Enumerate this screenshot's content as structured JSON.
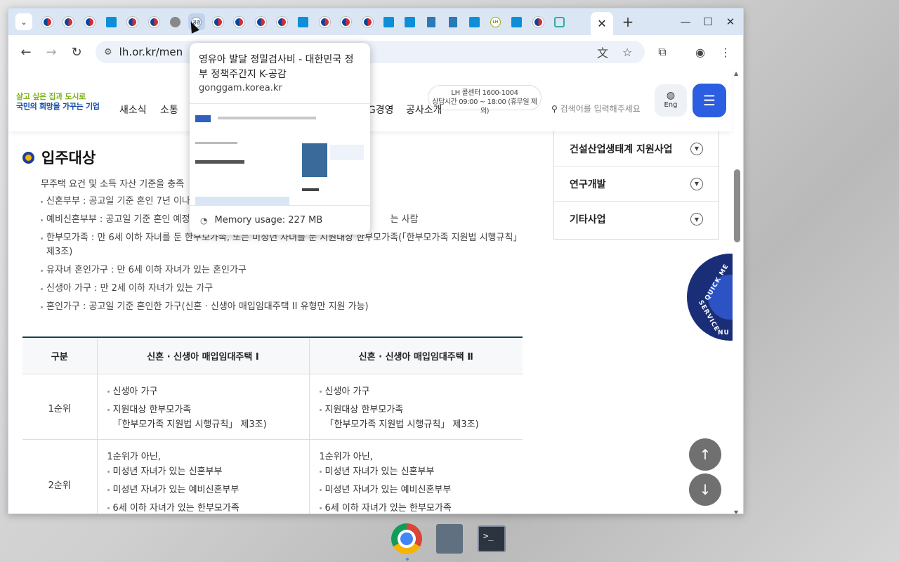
{
  "browser": {
    "tabs_count": 26,
    "current_tab_close": "✕",
    "new_tab": "+",
    "address": "lh.or.kr/men",
    "window_controls": [
      "minimize",
      "maximize",
      "close"
    ]
  },
  "hover_card": {
    "title": "영유아 발달 정밀검사비 - 대한민국 정부 정책주간지 K-공감",
    "domain": "gonggam.korea.kr",
    "memory": "Memory usage: 227 MB"
  },
  "site": {
    "logo_line1": "살고 싶은 집과 도시로",
    "logo_line2": "국민의 희망을 가꾸는 기업",
    "nav": [
      "새소식",
      "소통",
      "SG경영",
      "공사소개"
    ],
    "callcenter_line1": "LH 콜센터 1600-1004",
    "callcenter_line2": "상담시간 09:00 ~ 18:00 (휴무일 제외)",
    "search_placeholder": "검색어를 입력해주세요",
    "eng_label": "Eng"
  },
  "side_menu": [
    {
      "label": "건설산업생태계 지원사업"
    },
    {
      "label": "연구개발"
    },
    {
      "label": "기타사업"
    }
  ],
  "quick_menu_label": "QUICK MENU SERVICE",
  "content": {
    "section_title": "입주대상",
    "intro": "무주택 요건 및 소득 자산 기준을 충족",
    "bullets": [
      "신혼부부 : 공고일 기준 혼인 7년 이나",
      "예비신혼부부 : 공고일 기준 혼인 예정                                                                     는 사람",
      "한부모가족 : 만 6세 이하 자녀를 둔 한부모가족, 또는 미성년 자녀를 둔 지원대상 한부모가족(「한부모가족 지원법 시행규칙」 제3조)",
      "유자녀 혼인가구 : 만 6세 이하 자녀가 있는 혼인가구",
      "신생아 가구 : 만 2세 이하 자녀가 있는 가구",
      "혼인가구 : 공고일 기준 혼인한 가구(신혼 · 신생아 매입임대주택 II 유형만 지원 가능)"
    ],
    "table": {
      "headers": [
        "구분",
        "신혼 · 신생아 매입임대주택 Ⅰ",
        "신혼 · 신생아 매입임대주택 Ⅱ"
      ],
      "rows": [
        {
          "rank": "1순위",
          "col1": [
            "신생아 가구",
            "지원대상 한부모가족",
            "「한부모가족 지원법 시행규칙」 제3조)"
          ],
          "col2": [
            "신생아 가구",
            "지원대상 한부모가족",
            "「한부모가족 지원법 시행규칙」 제3조)"
          ]
        },
        {
          "rank": "2순위",
          "lead": "1순위가 아닌,",
          "col1": [
            "미성년 자녀가 있는 신혼부부",
            "미성년 자녀가 있는 예비신혼부부",
            "6세 이하 자녀가 있는 한부모가족"
          ],
          "col2": [
            "미성년 자녀가 있는 신혼부부",
            "미성년 자녀가 있는 예비신혼부부",
            "6세 이하 자녀가 있는 한부모가족"
          ]
        }
      ]
    }
  },
  "colors": {
    "tabstrip": "#dbe6f5",
    "primary_blue": "#2b5ee0",
    "table_border": "#17424d",
    "quick_menu": "#1a2e78"
  }
}
